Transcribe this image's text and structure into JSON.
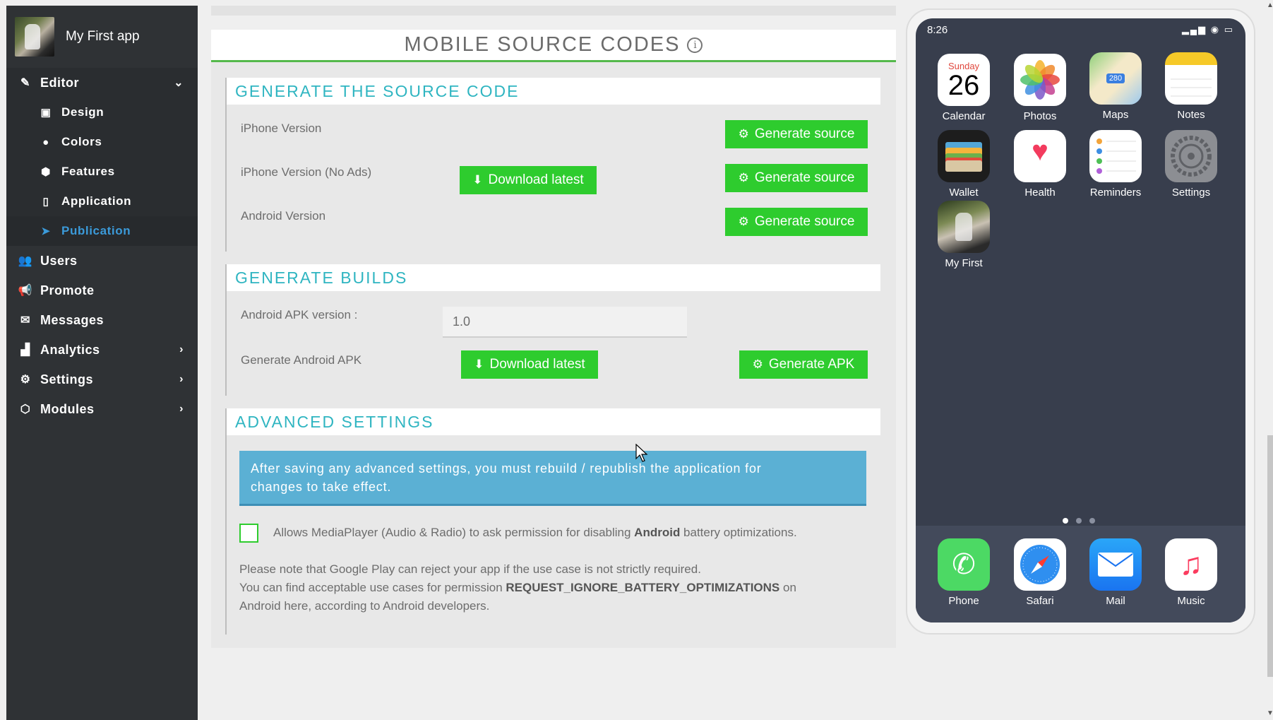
{
  "sidebar": {
    "app_name": "My First app",
    "editor": {
      "label": "Editor",
      "icon": "pencil-icon"
    },
    "sub_items": [
      {
        "label": "Design",
        "icon": "design-icon"
      },
      {
        "label": "Colors",
        "icon": "palette-icon"
      },
      {
        "label": "Features",
        "icon": "cube-icon"
      },
      {
        "label": "Application",
        "icon": "mobile-icon"
      },
      {
        "label": "Publication",
        "icon": "paper-plane-icon",
        "active": true
      }
    ],
    "items": [
      {
        "label": "Users",
        "icon": "users-icon"
      },
      {
        "label": "Promote",
        "icon": "megaphone-icon"
      },
      {
        "label": "Messages",
        "icon": "envelope-icon"
      },
      {
        "label": "Analytics",
        "icon": "bar-chart-icon"
      },
      {
        "label": "Settings",
        "icon": "wrench-icon"
      },
      {
        "label": "Modules",
        "icon": "cubes-icon"
      }
    ]
  },
  "main": {
    "title": "MOBILE SOURCE CODES",
    "info": "i",
    "source": {
      "title": "GENERATE THE SOURCE CODE",
      "rows": [
        {
          "label": "iPhone Version",
          "generate": "Generate source"
        },
        {
          "label": "iPhone Version (No Ads)",
          "download": "Download latest",
          "generate": "Generate source"
        },
        {
          "label": "Android Version",
          "generate": "Generate source"
        }
      ]
    },
    "builds": {
      "title": "GENERATE BUILDS",
      "apk_version_label": "Android APK version :",
      "apk_version_value": "1.0",
      "apk_label": "Generate Android APK",
      "download": "Download latest",
      "generate_apk": "Generate APK"
    },
    "advanced": {
      "title": "ADVANCED SETTINGS",
      "alert_line1": "After saving any advanced settings, you must rebuild / republish the application for",
      "alert_line2": "changes to take effect.",
      "checkbox_pre": "Allows MediaPlayer (Audio & Radio) to ask permission for disabling ",
      "checkbox_bold": "Android",
      "checkbox_post": " battery optimizations.",
      "note1": "Please note that Google Play can reject your app if the use case is not strictly required.",
      "note2_pre": "You can find acceptable use cases for permission ",
      "note2_bold": "REQUEST_IGNORE_BATTERY_OPTIMIZATIONS",
      "note2_post": " on",
      "note3": "Android here, according to Android developers."
    }
  },
  "phone": {
    "time": "8:26",
    "status_icons": "signal-wifi-battery",
    "calendar_day": "Sunday",
    "calendar_date": "26",
    "maps_badge": "280",
    "apps": [
      {
        "label": "Calendar",
        "icon": "calendar-icon"
      },
      {
        "label": "Photos",
        "icon": "photos-icon"
      },
      {
        "label": "Maps",
        "icon": "maps-icon"
      },
      {
        "label": "Notes",
        "icon": "notes-icon"
      },
      {
        "label": "Wallet",
        "icon": "wallet-icon"
      },
      {
        "label": "Health",
        "icon": "health-icon"
      },
      {
        "label": "Reminders",
        "icon": "reminders-icon"
      },
      {
        "label": "Settings",
        "icon": "settings-icon"
      },
      {
        "label": "My First",
        "icon": "my-first-app-icon"
      }
    ],
    "dock": [
      {
        "label": "Phone",
        "icon": "phone-icon"
      },
      {
        "label": "Safari",
        "icon": "safari-icon"
      },
      {
        "label": "Mail",
        "icon": "mail-icon"
      },
      {
        "label": "Music",
        "icon": "music-icon"
      }
    ]
  },
  "colors": {
    "green": "#2ecc2e",
    "teal": "#2fb5c1",
    "sidebar": "#2f3235",
    "active": "#3b9ad9",
    "alert": "#5bb0d4"
  }
}
